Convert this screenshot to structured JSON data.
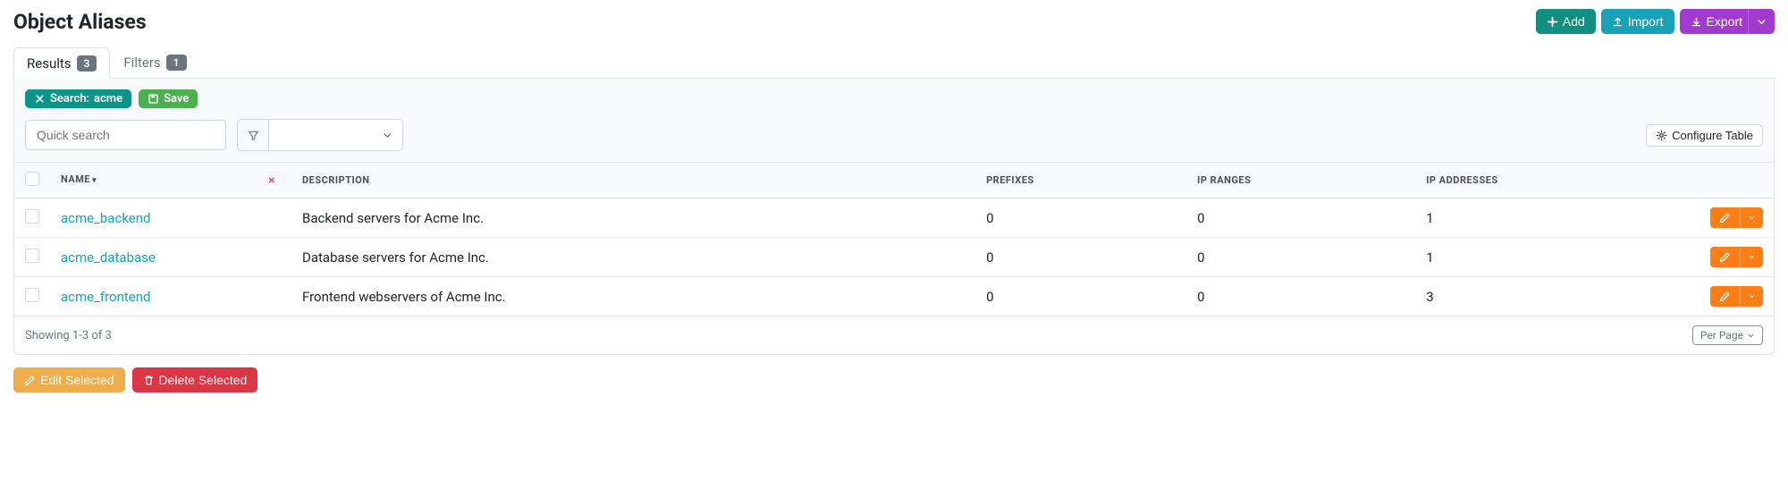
{
  "page_title": "Object Aliases",
  "header_actions": {
    "add_label": "Add",
    "import_label": "Import",
    "export_label": "Export"
  },
  "tabs": {
    "results": {
      "label": "Results",
      "count": "3"
    },
    "filters": {
      "label": "Filters",
      "count": "1"
    }
  },
  "filter_pill": {
    "prefix": "Search:",
    "value": "acme"
  },
  "save_pill": "Save",
  "search_placeholder": "Quick search",
  "configure_label": "Configure Table",
  "columns": {
    "name": "Name",
    "description": "Description",
    "prefixes": "Prefixes",
    "ip_ranges": "IP Ranges",
    "ip_addresses": "IP Addresses"
  },
  "rows": [
    {
      "name": "acme_backend",
      "description": "Backend servers for Acme Inc.",
      "prefixes": "0",
      "ip_ranges": "0",
      "ip_addresses": "1"
    },
    {
      "name": "acme_database",
      "description": "Database servers for Acme Inc.",
      "prefixes": "0",
      "ip_ranges": "0",
      "ip_addresses": "1"
    },
    {
      "name": "acme_frontend",
      "description": "Frontend webservers of Acme Inc.",
      "prefixes": "0",
      "ip_ranges": "0",
      "ip_addresses": "3"
    }
  ],
  "footer": {
    "showing": "Showing 1-3 of 3",
    "per_page": "Per Page"
  },
  "bulk": {
    "edit": "Edit Selected",
    "delete": "Delete Selected"
  }
}
